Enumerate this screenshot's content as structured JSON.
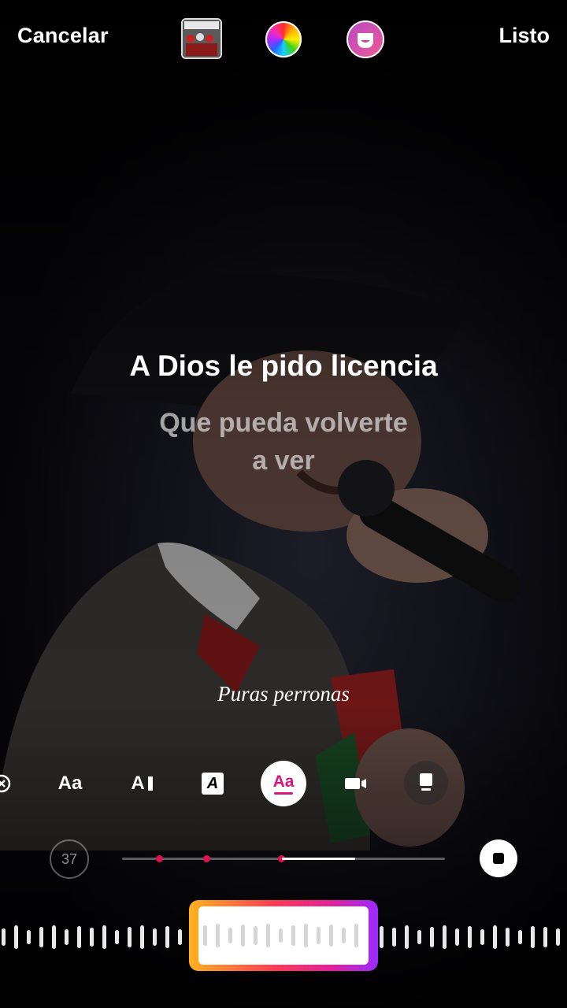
{
  "header": {
    "cancel_label": "Cancelar",
    "done_label": "Listo"
  },
  "lyrics": {
    "current_line": "A Dios le pido licencia",
    "next_line_1": "Que pueda volverte",
    "next_line_2": "a ver"
  },
  "caption": "Puras perronas",
  "toolbar": {
    "styles": [
      {
        "name": "close",
        "icon": "close-circle-icon"
      },
      {
        "name": "typewriter",
        "label": "Aa"
      },
      {
        "name": "cursor",
        "label": "A"
      },
      {
        "name": "boxed",
        "label": "A"
      },
      {
        "name": "highlight",
        "label": "Aa"
      },
      {
        "name": "video",
        "icon": "video-icon"
      },
      {
        "name": "phone",
        "icon": "phone-card-icon"
      }
    ]
  },
  "playback": {
    "duration_seconds": "37"
  },
  "colors": {
    "accent_pink": "#e0124f",
    "gradient_start": "#ffb21f",
    "gradient_end": "#9a2bff"
  }
}
